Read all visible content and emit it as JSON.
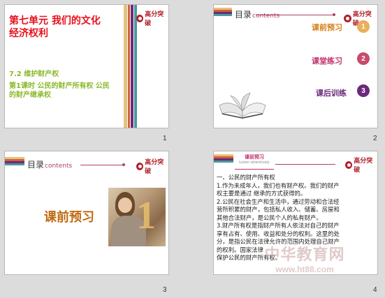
{
  "logo_text": "高分突破",
  "slides": [
    {
      "number": "1",
      "title": "第七单元 我们的文化经济权利",
      "section": "7.2 维护财产权",
      "lesson": "第1课时 公民的财产所有权 公民的财产继承权"
    },
    {
      "number": "2",
      "header_zh": "目录",
      "header_en": "contents",
      "items": [
        {
          "label": "课前预习",
          "index": "1"
        },
        {
          "label": "课堂练习",
          "index": "2"
        },
        {
          "label": "课后训练",
          "index": "3"
        }
      ]
    },
    {
      "number": "3",
      "header_zh": "目录",
      "header_en": "contents",
      "big_label": "课前预习",
      "big_index": "1"
    },
    {
      "number": "4",
      "tag_title": "课前预习",
      "tag_sub": "Listen attentively",
      "lines": [
        "一、公民的财产所有权",
        "1.作为未成年人，我们也有财产权。我们的财产",
        "权主要是通过 继承的方式获得的。",
        "2.公民在社会生产和生活中，通过劳动和合法经",
        "营所积累的财产，包括私人收入、储蓄、房屋和",
        "其他合法财产，是公民个人的私有财产。",
        "3.财产所有权是指财产所有人依法对自己的财产",
        "享有占有、使用、收益和处分的权利。这里的处",
        "分，是指公民在法律允许的范围内处理自己财产",
        "的权利。国家法律",
        "保护公民的财产所有权。"
      ]
    }
  ],
  "watermark": "中华教育网",
  "watermark_url": "www.ht88.com",
  "colors": {
    "accent_red": "#e8101c",
    "gold": "#d4801a",
    "green": "#8ab82a",
    "pink": "#c0306a",
    "purple": "#6a2a7a",
    "teal": "#2a9a8a"
  }
}
